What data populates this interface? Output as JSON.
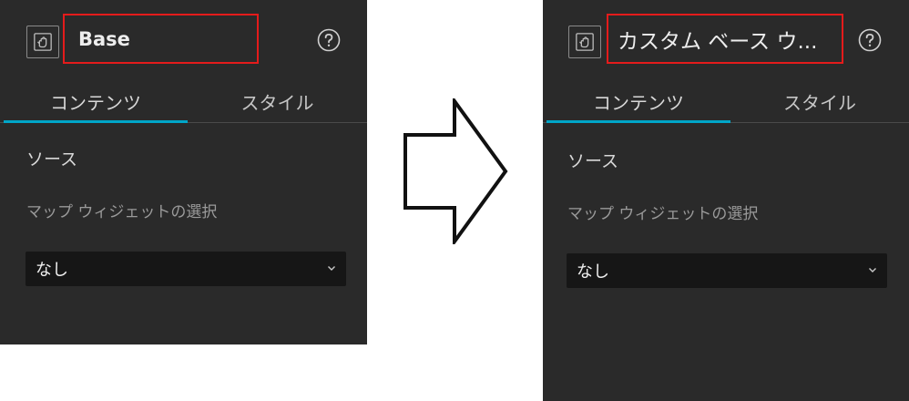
{
  "before": {
    "title": "Base",
    "tabs": [
      {
        "label": "コンテンツ",
        "active": true
      },
      {
        "label": "スタイル",
        "active": false
      }
    ],
    "section_title": "ソース",
    "field_label": "マップ ウィジェットの選択",
    "select_value": "なし"
  },
  "after": {
    "title": "カスタム ベース ウ...",
    "tabs": [
      {
        "label": "コンテンツ",
        "active": true
      },
      {
        "label": "スタイル",
        "active": false
      }
    ],
    "section_title": "ソース",
    "field_label": "マップ ウィジェットの選択",
    "select_value": "なし"
  },
  "icons": {
    "widget": "hand-icon",
    "help": "help-icon",
    "dropdown": "chevron-down-icon",
    "transition": "arrow-right-icon"
  },
  "colors": {
    "panel_bg": "#2a2a2a",
    "highlight_border": "#e41b1b",
    "tab_accent": "#00a6c8",
    "select_bg": "#161616"
  }
}
